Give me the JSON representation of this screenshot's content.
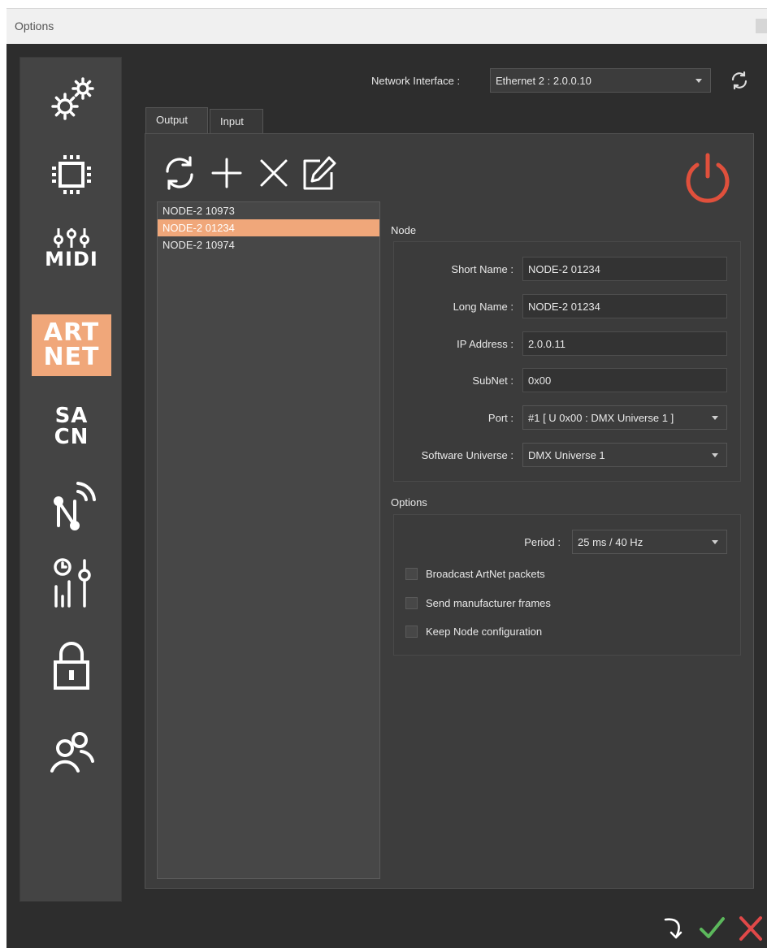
{
  "window": {
    "title": "Options"
  },
  "header": {
    "network_interface_label": "Network Interface :",
    "network_interface_value": "Ethernet 2 : 2.0.0.10"
  },
  "tabs": [
    {
      "label": "Output"
    },
    {
      "label": "Input"
    }
  ],
  "sidebar": {
    "items": [
      {
        "icon": "settings-icon"
      },
      {
        "icon": "chip-icon"
      },
      {
        "icon": "midi-icon",
        "text": "MIDI"
      },
      {
        "icon": "artnet-icon",
        "line1": "ART",
        "line2": "NET"
      },
      {
        "icon": "sacn-icon",
        "line1": "SA",
        "line2": "CN"
      },
      {
        "icon": "network-node-icon"
      },
      {
        "icon": "timer-fader-icon"
      },
      {
        "icon": "lock-icon"
      },
      {
        "icon": "users-icon"
      }
    ]
  },
  "node_list": [
    {
      "label": "NODE-2  10973"
    },
    {
      "label": "NODE-2 01234"
    },
    {
      "label": "NODE-2 10974"
    }
  ],
  "node": {
    "group_title": "Node",
    "short_name_label": "Short Name :",
    "short_name_value": "NODE-2 01234",
    "long_name_label": "Long Name :",
    "long_name_value": "NODE-2 01234",
    "ip_label": "IP Address :",
    "ip_value": "2.0.0.11",
    "subnet_label": "SubNet :",
    "subnet_value": "0x00",
    "port_label": "Port :",
    "port_value": "#1 [ U 0x00 : DMX Universe 1 ]",
    "universe_label": "Software Universe :",
    "universe_value": "DMX Universe 1"
  },
  "options": {
    "group_title": "Options",
    "period_label": "Period :",
    "period_value": "25 ms / 40 Hz",
    "broadcast_label": "Broadcast ArtNet packets",
    "manufacturer_label": "Send manufacturer frames",
    "keep_config_label": "Keep Node configuration"
  },
  "colors": {
    "accent": "#f0a77a",
    "power": "#e0503c",
    "confirm": "#5cb85c",
    "cancel": "#e04848"
  }
}
